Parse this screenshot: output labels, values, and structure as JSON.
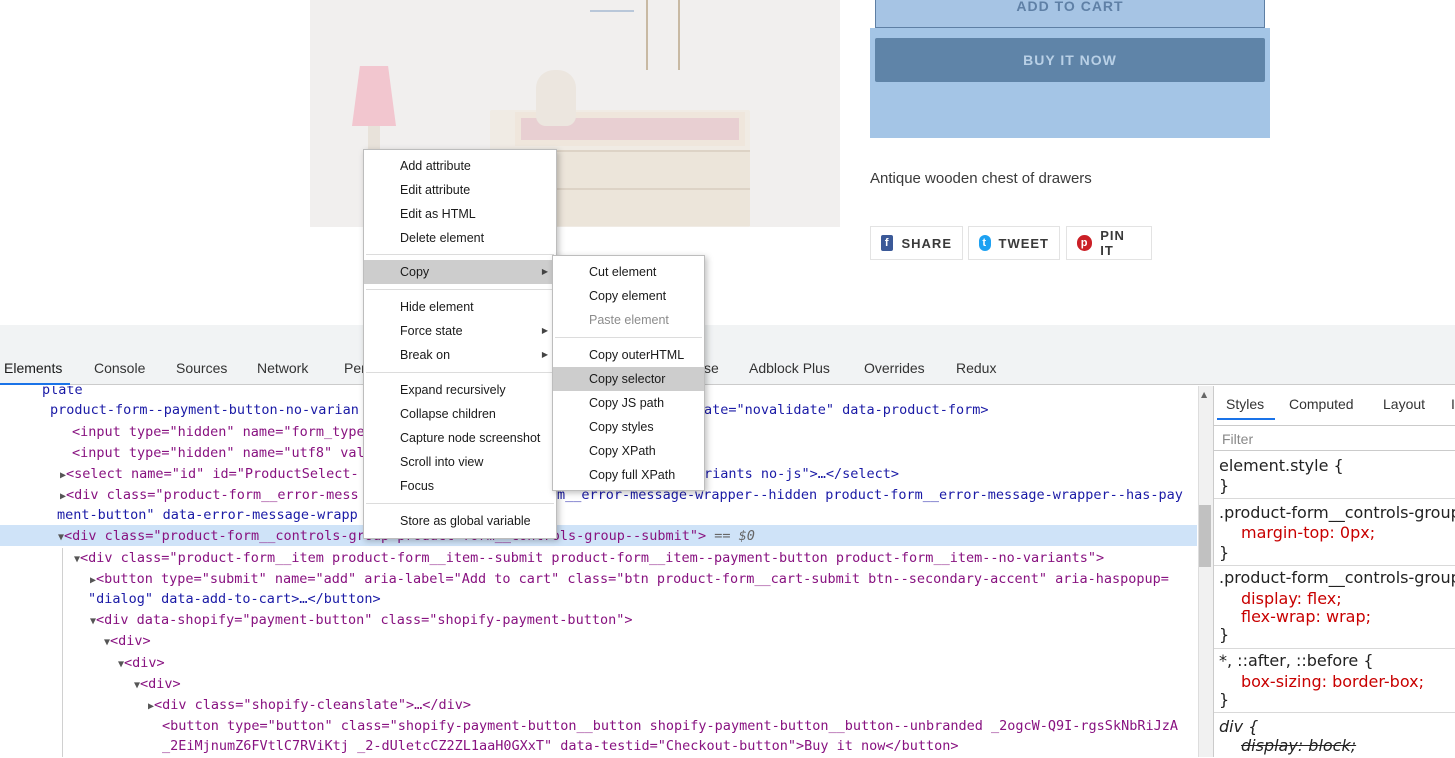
{
  "store": {
    "add_to_cart": "ADD TO CART",
    "buy_now": "BUY IT NOW",
    "description": "Antique wooden chest of drawers",
    "share": [
      {
        "icon": "facebook-icon",
        "label": "SHARE",
        "color": "#3b5998"
      },
      {
        "icon": "twitter-icon",
        "label": "TWEET",
        "color": "#1da1f2"
      },
      {
        "icon": "pinterest-icon",
        "label": "PIN IT",
        "color": "#cb2027"
      }
    ]
  },
  "devtools": {
    "tabs": [
      "Elements",
      "Console",
      "Sources",
      "Network",
      "Per",
      "se",
      "Adblock Plus",
      "Overrides",
      "Redux"
    ],
    "active_tab": "Elements",
    "side_tabs": [
      "Styles",
      "Computed",
      "Layout",
      "I"
    ],
    "filter_placeholder": "Filter",
    "selected_suffix": "== $0"
  },
  "context_menu": {
    "items": [
      {
        "label": "Add attribute"
      },
      {
        "label": "Edit attribute"
      },
      {
        "label": "Edit as HTML"
      },
      {
        "label": "Delete element"
      },
      {
        "label": "Copy",
        "submenu": true,
        "highlighted": true
      },
      {
        "label": "Hide element"
      },
      {
        "label": "Force state",
        "submenu": true
      },
      {
        "label": "Break on",
        "submenu": true
      },
      {
        "label": "Expand recursively"
      },
      {
        "label": "Collapse children"
      },
      {
        "label": "Capture node screenshot"
      },
      {
        "label": "Scroll into view"
      },
      {
        "label": "Focus"
      },
      {
        "label": "Store as global variable"
      }
    ]
  },
  "copy_submenu": {
    "items": [
      {
        "label": "Cut element"
      },
      {
        "label": "Copy element"
      },
      {
        "label": "Paste element",
        "disabled": true
      },
      {
        "label": "Copy outerHTML"
      },
      {
        "label": "Copy selector",
        "highlighted": true
      },
      {
        "label": "Copy JS path"
      },
      {
        "label": "Copy styles"
      },
      {
        "label": "Copy XPath"
      },
      {
        "label": "Copy full XPath"
      }
    ]
  },
  "dom_lines": [
    "plate",
    "product-form--payment-button-no-varian",
    "ate=\"novalidate\" data-product-form>",
    "<input type=\"hidden\" name=\"form_type",
    "<input type=\"hidden\" name=\"utf8\" val",
    "<select name=\"id\" id=\"ProductSelect-",
    "riants no-js\">…</select>",
    "<div class=\"product-form__error-mess",
    "m__error-message-wrapper--hidden product-form__error-message-wrapper--has-pay",
    "ment-button\" data-error-message-wrapp",
    "<div class=\"product-form__controls-group product-form__controls-group--submit\">",
    "<div class=\"product-form__item product-form__item--submit product-form__item--payment-button product-form__item--no-variants\">",
    "<button type=\"submit\" name=\"add\" aria-label=\"Add to cart\" class=\"btn product-form__cart-submit btn--secondary-accent\" aria-haspopup=",
    "\"dialog\" data-add-to-cart>…</button>",
    "<div data-shopify=\"payment-button\" class=\"shopify-payment-button\">",
    "<div>",
    "<div>",
    "<div>",
    "<div class=\"shopify-cleanslate\">…</div>",
    "<button type=\"button\" class=\"shopify-payment-button__button shopify-payment-button__button--unbranded _2ogcW-Q9I-rgsSkNbRiJzA",
    "_2EiMjnumZ6FVtlC7RViKtj _2-dUletcCZ2ZL1aaH0GXxT\" data-testid=\"Checkout-button\">Buy it now</button>"
  ],
  "styles_lines": [
    "element.style {",
    "}",
    ".product-form__controls-group",
    "margin-top: 0px;",
    "}",
    ".product-form__controls-group",
    "display: flex;",
    "flex-wrap: wrap;",
    "}",
    "*, ::after, ::before {",
    "box-sizing: border-box;",
    "}",
    "div {",
    "display: block;"
  ]
}
